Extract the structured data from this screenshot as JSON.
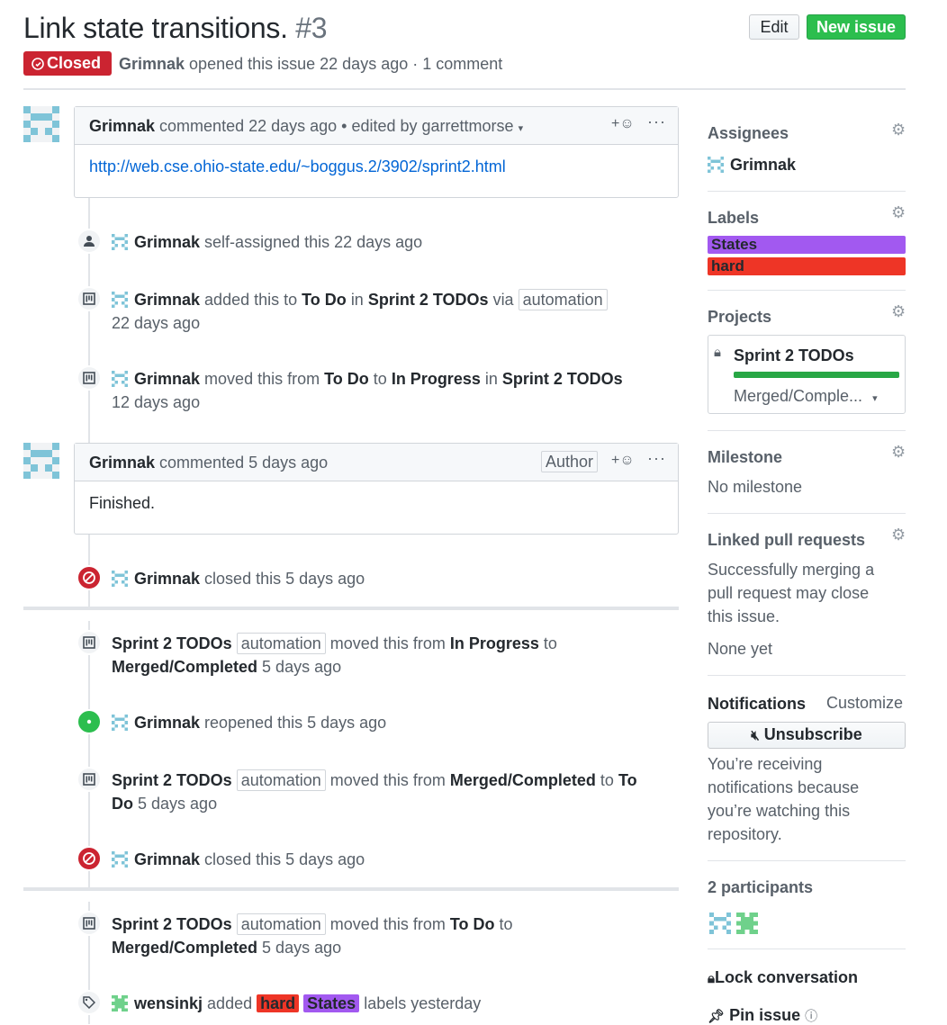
{
  "issue": {
    "title": "Link state transitions.",
    "number": "#3",
    "state": "Closed",
    "author": "Grimnak",
    "opened_text": "opened this issue 22 days ago · 1 comment",
    "edit_label": "Edit",
    "new_issue_label": "New issue"
  },
  "comments": [
    {
      "author": "Grimnak",
      "meta": "commented 22 days ago • edited by garrettmorse",
      "body_link": "http://web.cse.ohio-state.edu/~boggus.2/3902/sprint2.html"
    },
    {
      "author": "Grimnak",
      "meta": "commented 5 days ago",
      "author_badge": "Author",
      "body": "Finished."
    }
  ],
  "events": {
    "e1": {
      "actor": "Grimnak",
      "text": "self-assigned this 22 days ago"
    },
    "e2": {
      "actor": "Grimnak",
      "t1": "added this to",
      "col": "To Do",
      "t2": "in",
      "project": "Sprint 2 TODOs",
      "t3": "via",
      "tag": "automation",
      "time": "22 days ago"
    },
    "e3": {
      "actor": "Grimnak",
      "t1": "moved this from",
      "from": "To Do",
      "t2": "to",
      "to": "In Progress",
      "t3": "in",
      "project": "Sprint 2 TODOs",
      "time": "12 days ago"
    },
    "e4": {
      "actor": "Grimnak",
      "text": "closed this 5 days ago"
    },
    "e5": {
      "project": "Sprint 2 TODOs",
      "tag": "automation",
      "t1": "moved this from",
      "from": "In Progress",
      "t2": "to",
      "to": "Merged/Completed",
      "time": "5 days ago"
    },
    "e6": {
      "actor": "Grimnak",
      "text": "reopened this 5 days ago"
    },
    "e7": {
      "project": "Sprint 2 TODOs",
      "tag": "automation",
      "t1": "moved this from",
      "from": "Merged/Completed",
      "t2": "to",
      "to_a": "To",
      "to_b": "Do",
      "time": "5 days ago"
    },
    "e8": {
      "actor": "Grimnak",
      "text": "closed this 5 days ago"
    },
    "e9": {
      "project": "Sprint 2 TODOs",
      "tag": "automation",
      "t1": "moved this from",
      "from": "To Do",
      "t2": "to",
      "to": "Merged/Completed",
      "time": "5 days ago"
    },
    "e10": {
      "actor": "wensinkj",
      "t1": "added",
      "label_a": "hard",
      "label_b": "States",
      "t2": "labels yesterday"
    }
  },
  "sidebar": {
    "assignees": {
      "heading": "Assignees",
      "name": "Grimnak"
    },
    "labels": {
      "heading": "Labels",
      "items": [
        "States",
        "hard"
      ]
    },
    "projects": {
      "heading": "Projects",
      "name": "Sprint 2 TODOs",
      "column": "Merged/Comple...",
      "progress": 1.0
    },
    "milestone": {
      "heading": "Milestone",
      "value": "No milestone"
    },
    "linked_prs": {
      "heading": "Linked pull requests",
      "desc_1": "Successfully merging a",
      "desc_2": "pull request may close",
      "desc_3": "this issue.",
      "value": "None yet"
    },
    "notifications": {
      "heading": "Notifications",
      "customize": "Customize",
      "button": "Unsubscribe",
      "desc_1": "You’re receiving",
      "desc_2": "notifications because",
      "desc_3": "you’re watching this",
      "desc_4": "repository."
    },
    "participants": {
      "heading": "2 participants"
    },
    "lock_label": "Lock conversation",
    "pin_label": "Pin issue"
  },
  "colors": {
    "closed": "#cb2431",
    "open": "#2cbe4e",
    "label_states": "#a259f0",
    "label_hard": "#ee3526",
    "link": "#0366d6"
  }
}
